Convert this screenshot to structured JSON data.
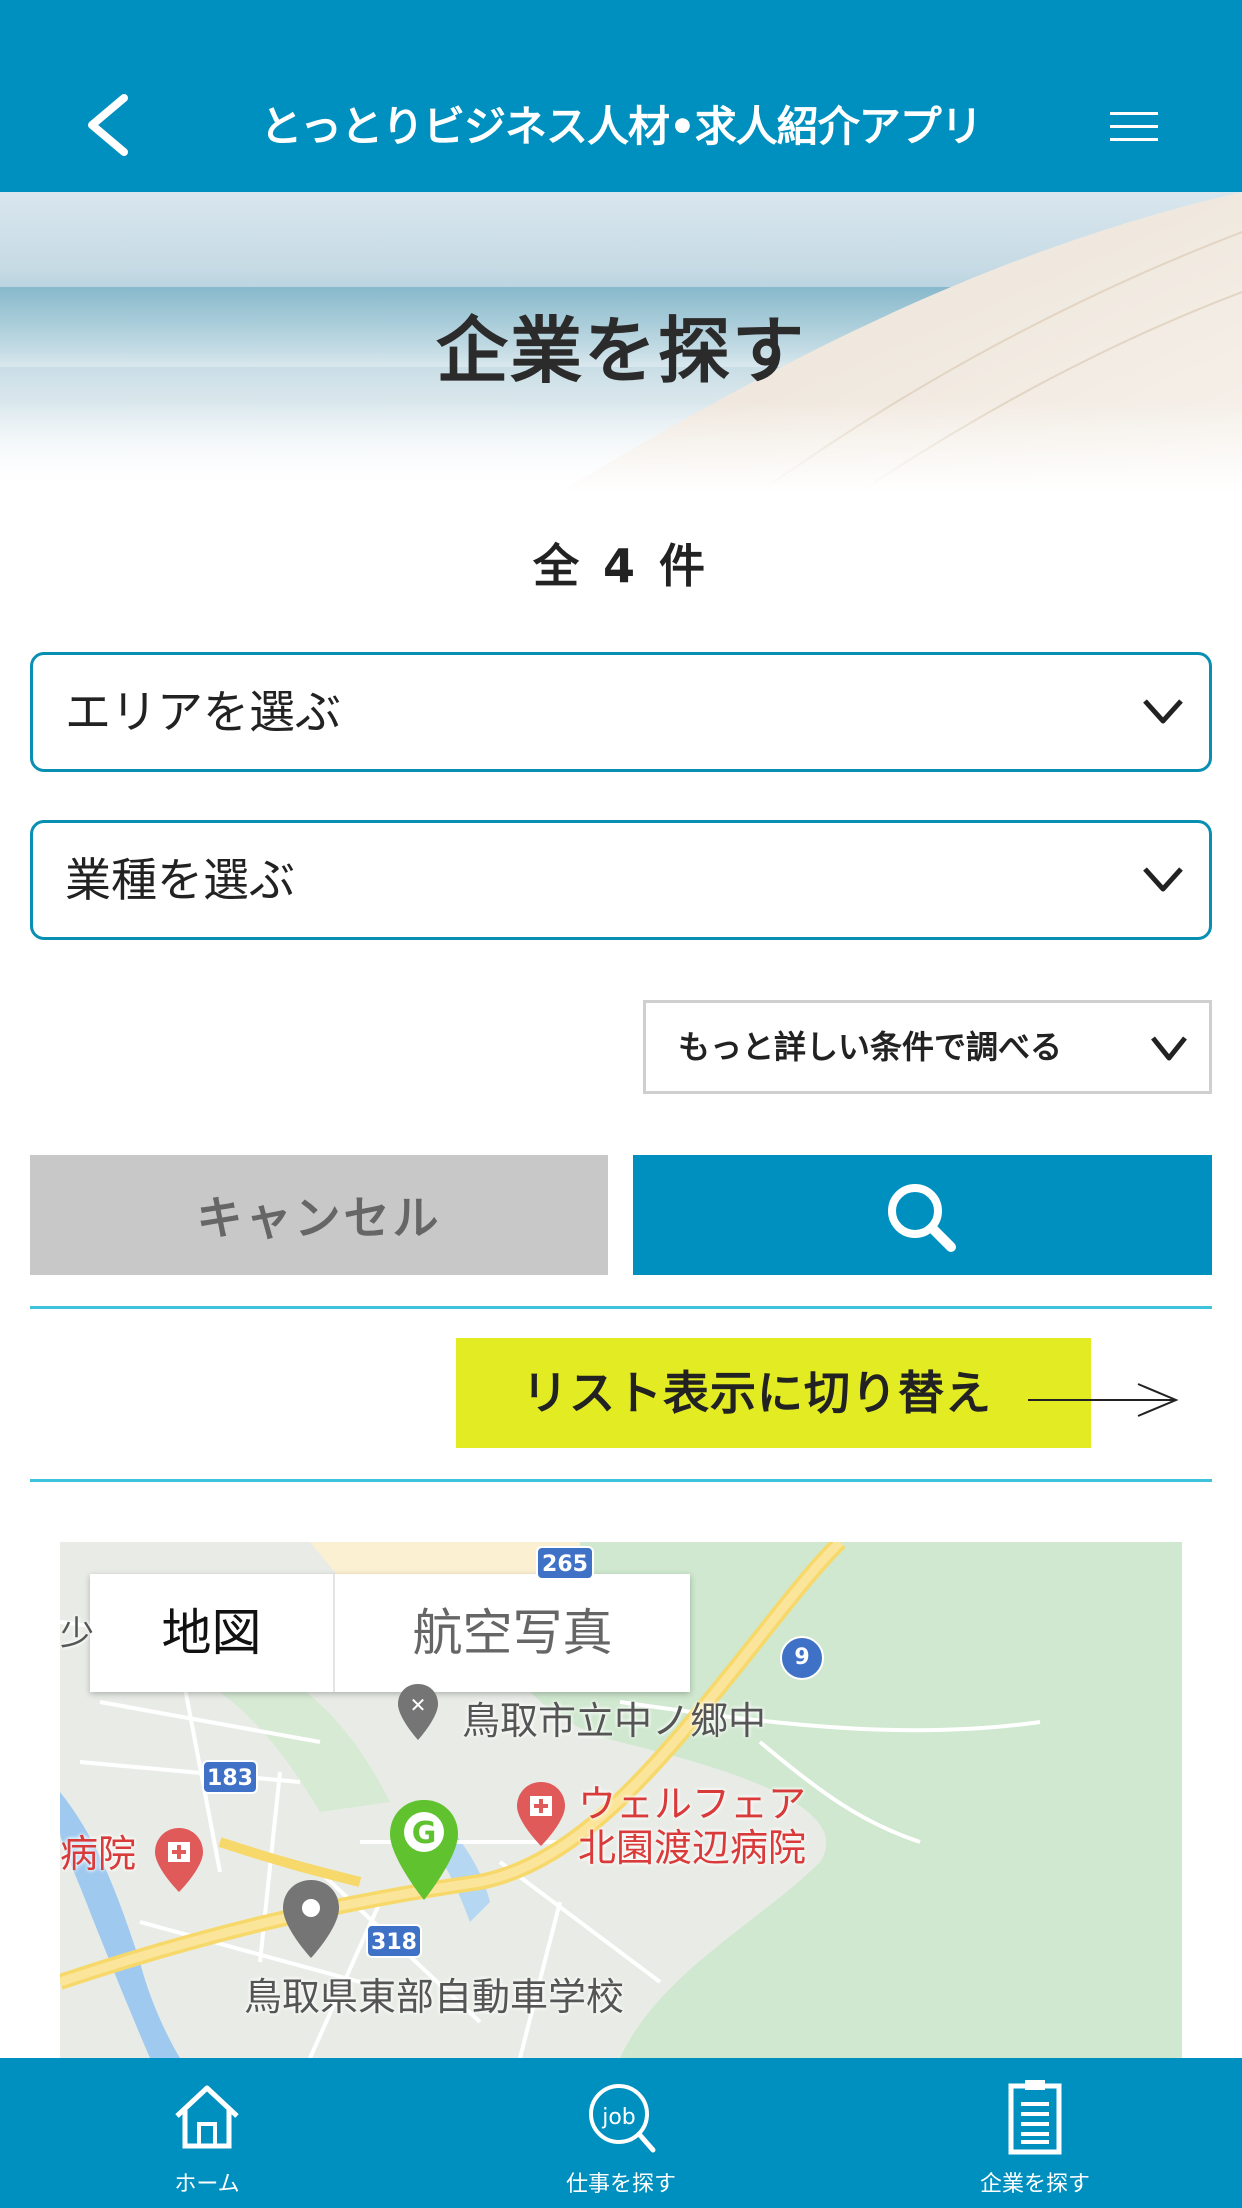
{
  "header": {
    "title": "とっとりビジネス人材•求人紹介アプリ",
    "back_icon": "chevron-left-icon",
    "menu_icon": "hamburger-menu-icon"
  },
  "hero": {
    "title": "企業を探す"
  },
  "result_count": "全 4 件",
  "filters": {
    "area_select": "エリアを選ぶ",
    "industry_select": "業種を選ぶ",
    "more_conditions": "もっと詳しい条件で調べる"
  },
  "actions": {
    "cancel_label": "キャンセル",
    "search_icon": "search-icon"
  },
  "view_toggle": {
    "label": "リスト表示に切り替え"
  },
  "map": {
    "tabs": [
      "地図",
      "航空写真"
    ],
    "labels": {
      "school": "鳥取市立中ノ郷中",
      "hospital_line1": "ウェルフェア",
      "hospital_line2": "北園渡辺病院",
      "hospital_left": "病院",
      "driving_school": "鳥取県東部自動車学校",
      "top_left_partial": "少"
    },
    "route_shields": [
      "265",
      "9",
      "183",
      "318"
    ],
    "marker_letter": "G"
  },
  "tabbar": {
    "items": [
      {
        "label": "ホーム",
        "icon": "home-icon"
      },
      {
        "label": "仕事を探す",
        "icon": "job-search-icon"
      },
      {
        "label": "企業を探す",
        "icon": "document-icon"
      }
    ],
    "job_icon_text": "job"
  },
  "colors": {
    "primary": "#0090bf",
    "accent_yellow": "#e3ec23",
    "border_teal": "#0a8fb3",
    "cancel_gray": "#c8c8c8"
  }
}
